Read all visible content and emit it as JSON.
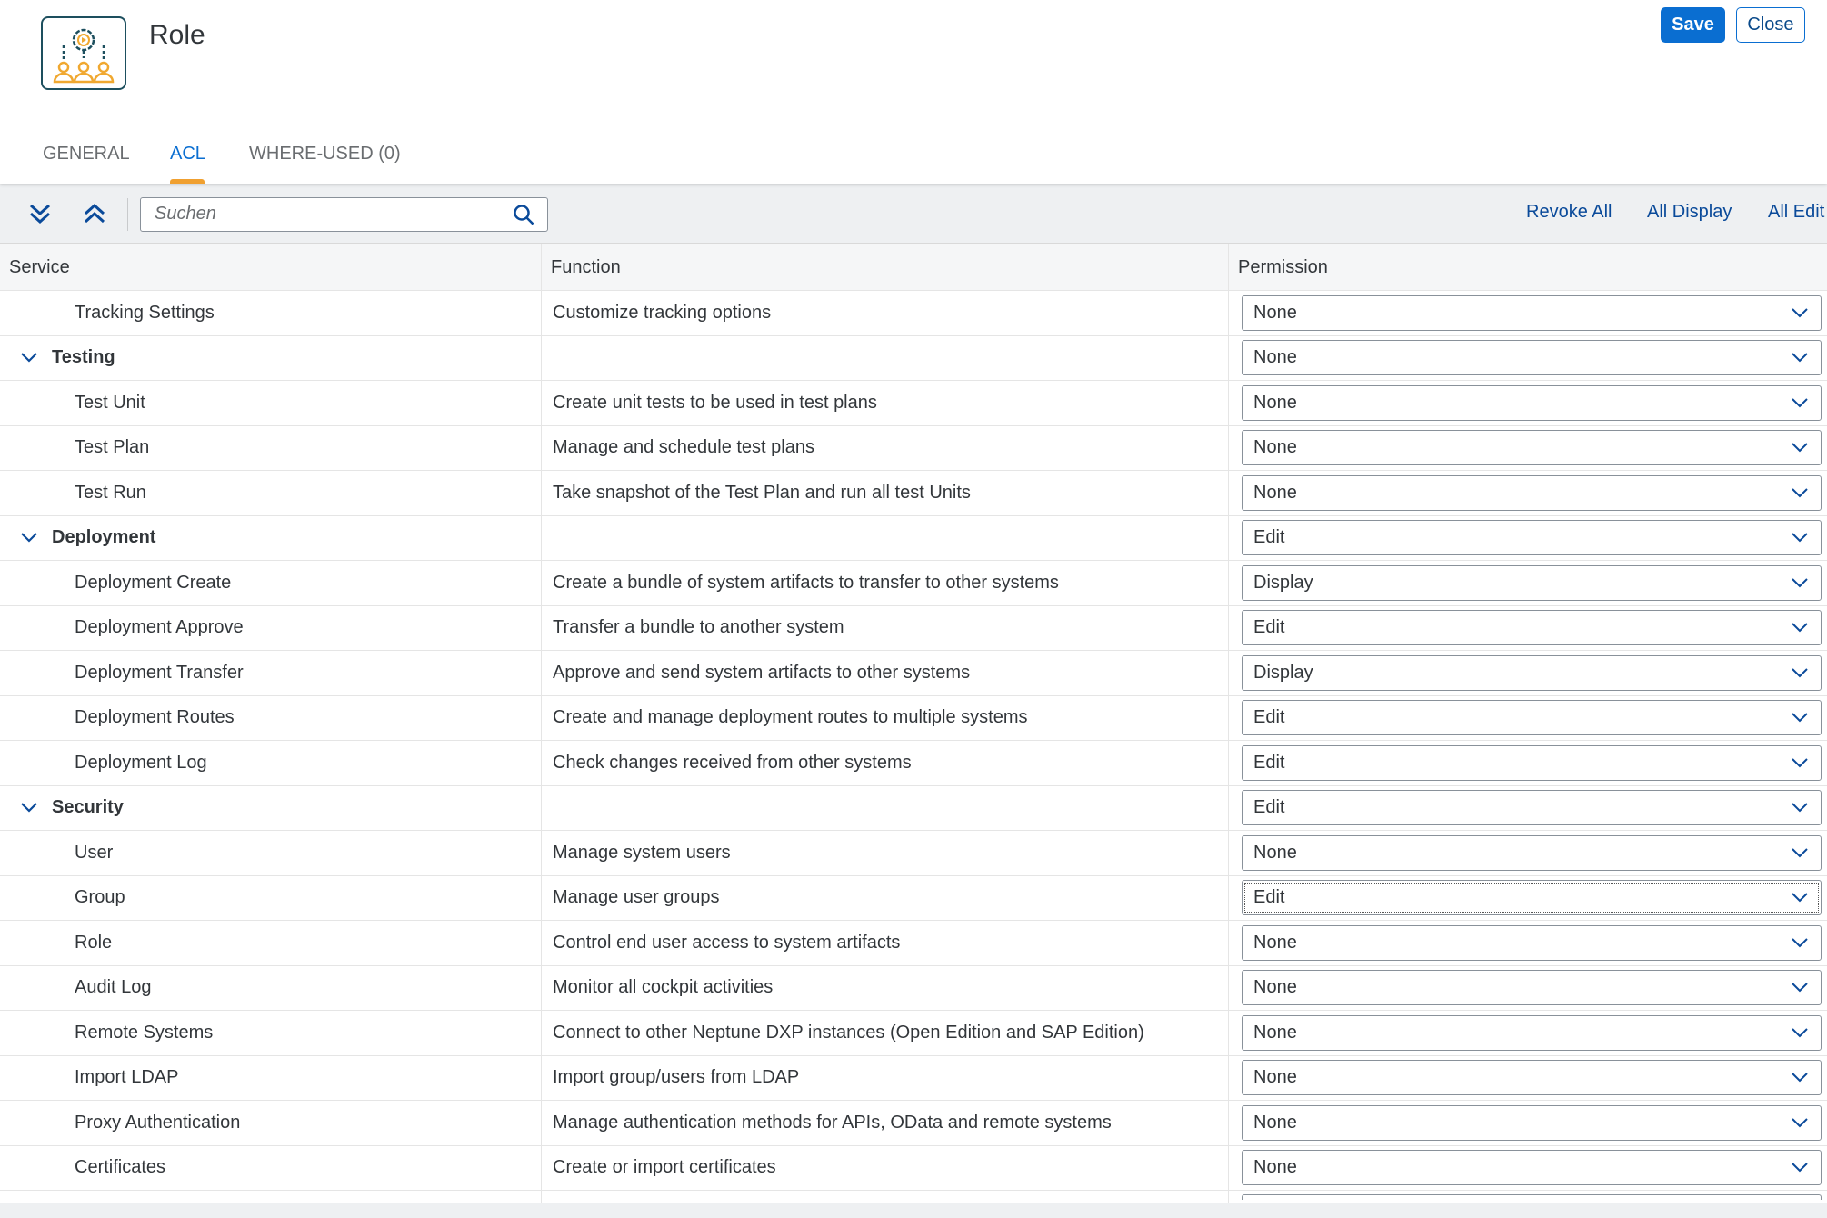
{
  "header": {
    "title": "Role",
    "save_label": "Save",
    "close_label": "Close",
    "logo_icon": "role-gear-users-icon"
  },
  "tabs": [
    {
      "label": "GENERAL"
    },
    {
      "label": "ACL",
      "active": true
    },
    {
      "label": "WHERE-USED (0)"
    }
  ],
  "toolbar": {
    "search_placeholder": "Suchen",
    "revoke_all": "Revoke All",
    "all_display": "All Display",
    "all_edit": "All Edit"
  },
  "table": {
    "columns": [
      "Service",
      "Function",
      "Permission"
    ],
    "rows": [
      {
        "service": "Tracking Settings",
        "function": "Customize tracking options",
        "permission": "None"
      },
      {
        "service": "Testing",
        "function": "",
        "permission": "None",
        "group": true
      },
      {
        "service": "Test Unit",
        "function": "Create unit tests to be used in test plans",
        "permission": "None"
      },
      {
        "service": "Test Plan",
        "function": "Manage and schedule test plans",
        "permission": "None"
      },
      {
        "service": "Test Run",
        "function": "Take snapshot of the Test Plan and run all test Units",
        "permission": "None"
      },
      {
        "service": "Deployment",
        "function": "",
        "permission": "Edit",
        "group": true
      },
      {
        "service": "Deployment Create",
        "function": "Create a bundle of system artifacts to transfer to other systems",
        "permission": "Display"
      },
      {
        "service": "Deployment Approve",
        "function": "Transfer a bundle to another system",
        "permission": "Edit"
      },
      {
        "service": "Deployment Transfer",
        "function": "Approve and send system artifacts to other systems",
        "permission": "Display"
      },
      {
        "service": "Deployment Routes",
        "function": "Create and manage deployment routes to multiple systems",
        "permission": "Edit"
      },
      {
        "service": "Deployment Log",
        "function": "Check changes received from other systems",
        "permission": "Edit"
      },
      {
        "service": "Security",
        "function": "",
        "permission": "Edit",
        "group": true
      },
      {
        "service": "User",
        "function": "Manage system users",
        "permission": "None"
      },
      {
        "service": "Group",
        "function": "Manage user groups",
        "permission": "Edit",
        "focused": true
      },
      {
        "service": "Role",
        "function": "Control end user access to system artifacts",
        "permission": "None"
      },
      {
        "service": "Audit Log",
        "function": "Monitor all cockpit activities",
        "permission": "None"
      },
      {
        "service": "Remote Systems",
        "function": "Connect to other Neptune DXP instances (Open Edition and SAP Edition)",
        "permission": "None"
      },
      {
        "service": "Import LDAP",
        "function": "Import group/users from LDAP",
        "permission": "None"
      },
      {
        "service": "Proxy Authentication",
        "function": "Manage authentication methods for APIs, OData and remote systems",
        "permission": "None"
      },
      {
        "service": "Certificates",
        "function": "Create or import certificates",
        "permission": "None"
      }
    ]
  },
  "colors": {
    "accent": "#0a6ed1",
    "tab_indicator": "#f0a030",
    "logo_orange": "#f0a830",
    "logo_dark": "#1d4f5e"
  }
}
